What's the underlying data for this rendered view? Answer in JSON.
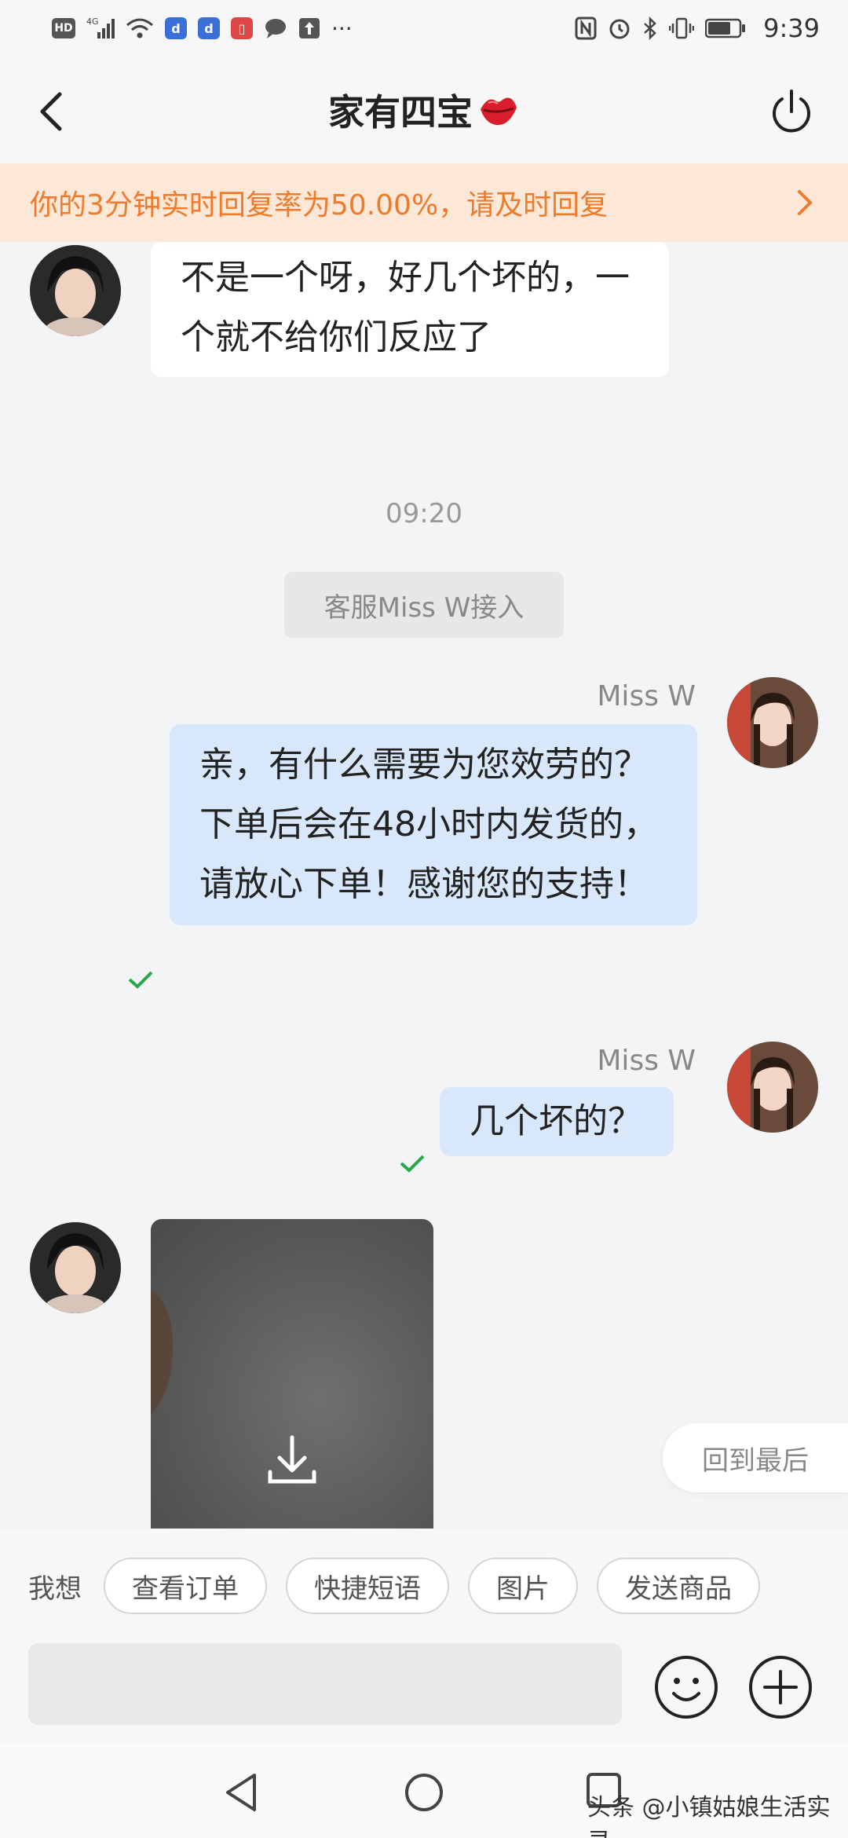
{
  "status_bar": {
    "left_badges": [
      "HD",
      "4G"
    ],
    "time": "9:39",
    "more": "···"
  },
  "header": {
    "title": "家有四宝"
  },
  "notice": {
    "text": "你的3分钟实时回复率为50.00%，请及时回复"
  },
  "messages": {
    "incoming_1": "不是一个呀，好几个坏的，一个就不给你们反应了",
    "timestamp": "09:20",
    "system": "客服Miss W接入",
    "out_1": {
      "sender": "Miss W",
      "text": "亲，有什么需要为您效劳的？下单后会在48小时内发货的，请放心下单！感谢您的支持！"
    },
    "out_2": {
      "sender": "Miss W",
      "text": "几个坏的？"
    }
  },
  "back_to_last": "回到最后",
  "quick_bar": {
    "label": "我想",
    "chips": [
      "查看订单",
      "快捷短语",
      "图片",
      "发送商品"
    ]
  },
  "watermark": "头条 @小镇姑娘生活实录",
  "colors": {
    "notice_text": "#ee7b2b",
    "notice_bg": "#fde7d6",
    "bubble_out": "#d9e7fb",
    "check": "#27a844"
  }
}
